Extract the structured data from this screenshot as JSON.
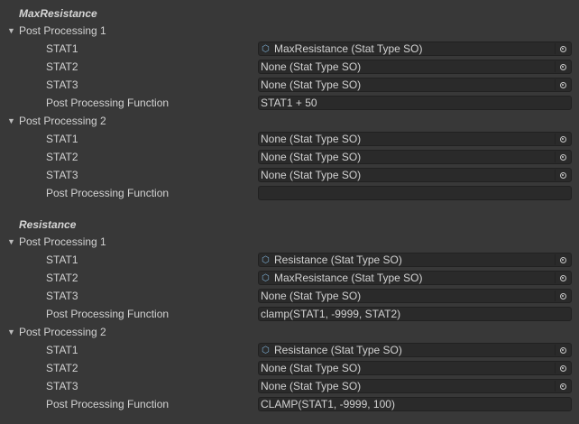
{
  "sections": [
    {
      "title": "MaxResistance",
      "groups": [
        {
          "label": "Post Processing 1",
          "stat1": {
            "label": "STAT1",
            "value": "MaxResistance (Stat Type SO)"
          },
          "stat2": {
            "label": "STAT2",
            "value": "None (Stat Type SO)"
          },
          "stat3": {
            "label": "STAT3",
            "value": "None (Stat Type SO)"
          },
          "func": {
            "label": "Post Processing Function",
            "value": "STAT1 + 50"
          }
        },
        {
          "label": "Post Processing 2",
          "stat1": {
            "label": "STAT1",
            "value": "None (Stat Type SO)"
          },
          "stat2": {
            "label": "STAT2",
            "value": "None (Stat Type SO)"
          },
          "stat3": {
            "label": "STAT3",
            "value": "None (Stat Type SO)"
          },
          "func": {
            "label": "Post Processing Function",
            "value": ""
          }
        }
      ]
    },
    {
      "title": "Resistance",
      "groups": [
        {
          "label": "Post Processing 1",
          "stat1": {
            "label": "STAT1",
            "value": "Resistance (Stat Type SO)"
          },
          "stat2": {
            "label": "STAT2",
            "value": "MaxResistance (Stat Type SO)"
          },
          "stat3": {
            "label": "STAT3",
            "value": "None (Stat Type SO)"
          },
          "func": {
            "label": "Post Processing Function",
            "value": "clamp(STAT1, -9999, STAT2)"
          }
        },
        {
          "label": "Post Processing 2",
          "stat1": {
            "label": "STAT1",
            "value": "Resistance (Stat Type SO)"
          },
          "stat2": {
            "label": "STAT2",
            "value": "None (Stat Type SO)"
          },
          "stat3": {
            "label": "STAT3",
            "value": "None (Stat Type SO)"
          },
          "func": {
            "label": "Post Processing Function",
            "value": "CLAMP(STAT1, -9999, 100)"
          }
        }
      ]
    }
  ],
  "icons": {
    "foldout": "triangle-down-icon",
    "asset": "scriptable-object-icon",
    "picker": "object-picker-icon"
  },
  "colors": {
    "background": "#383838",
    "field": "#2a2a2a",
    "text": "#d2d2d2",
    "asset_icon": "#7fb2d8"
  }
}
